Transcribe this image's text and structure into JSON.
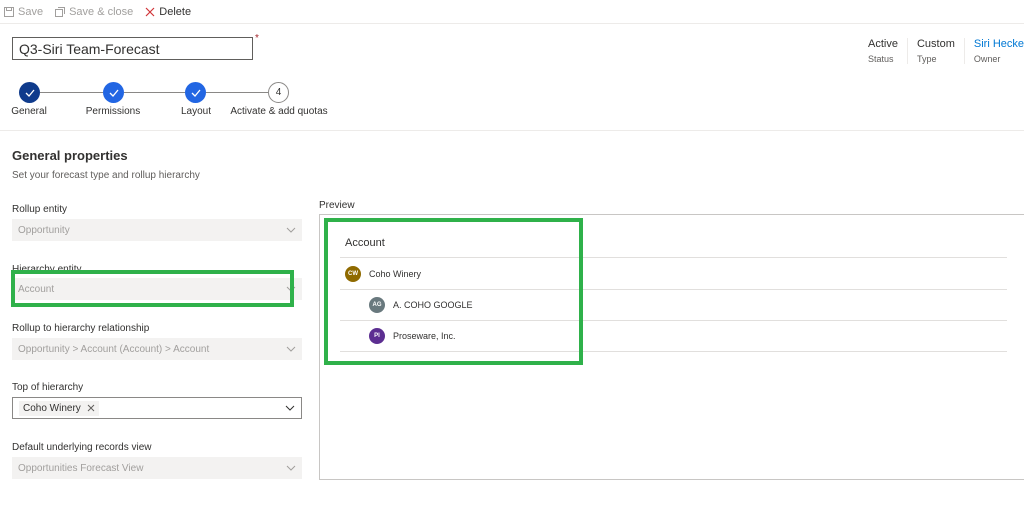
{
  "toolbar": {
    "save": "Save",
    "save_close": "Save & close",
    "delete": "Delete"
  },
  "header": {
    "title": "Q3-Siri Team-Forecast",
    "required_marker": "*",
    "fields": [
      {
        "value": "Active",
        "label": "Status"
      },
      {
        "value": "Custom",
        "label": "Type"
      },
      {
        "value": "Siri Hecke",
        "label": "Owner"
      }
    ]
  },
  "stepper": {
    "steps": [
      {
        "label": "General",
        "state": "current"
      },
      {
        "label": "Permissions",
        "state": "done"
      },
      {
        "label": "Layout",
        "state": "done"
      },
      {
        "label": "Activate & add quotas",
        "state": "todo",
        "number": "4"
      }
    ]
  },
  "general": {
    "title": "General properties",
    "subtitle": "Set your forecast type and rollup hierarchy",
    "fields": [
      {
        "label": "Rollup entity",
        "value": "Opportunity"
      },
      {
        "label": "Hierarchy entity",
        "value": "Account"
      },
      {
        "label": "Rollup to hierarchy relationship",
        "value": "Opportunity > Account (Account) > Account"
      },
      {
        "label": "Top of hierarchy",
        "value": "Coho Winery"
      },
      {
        "label": "Default underlying records view",
        "value": "Opportunities Forecast View"
      }
    ]
  },
  "preview": {
    "label": "Preview",
    "header": "Account",
    "rows": [
      {
        "initials": "CW",
        "name": "Coho Winery",
        "color": "#8f6a00"
      },
      {
        "initials": "AG",
        "name": "A. COHO GOOGLE",
        "color": "#69797e"
      },
      {
        "initials": "PI",
        "name": "Proseware, Inc.",
        "color": "#5c2e91"
      }
    ]
  },
  "colors": {
    "highlight": "#2fb14a",
    "accent": "#2266e3",
    "link": "#0078d4"
  }
}
